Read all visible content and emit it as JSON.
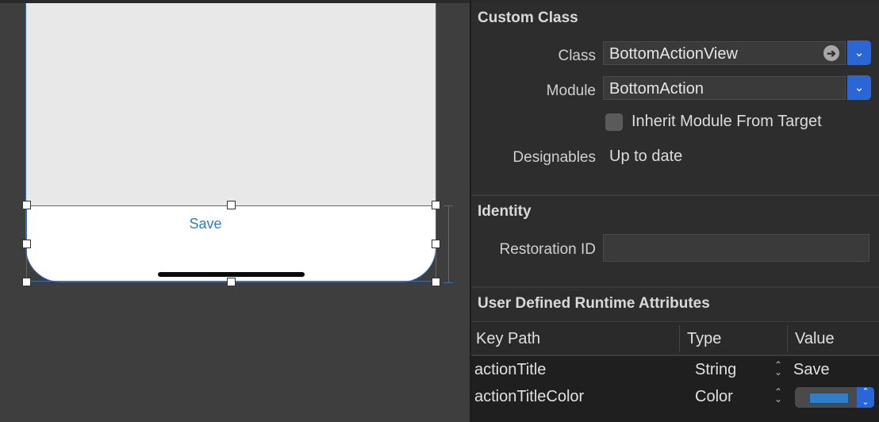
{
  "canvas": {
    "save_label": "Save"
  },
  "custom_class": {
    "title": "Custom Class",
    "class_label": "Class",
    "class_value": "BottomActionView",
    "module_label": "Module",
    "module_value": "BottomAction",
    "inherit_label": "Inherit Module From Target",
    "designables_label": "Designables",
    "designables_value": "Up to date"
  },
  "identity": {
    "title": "Identity",
    "restoration_label": "Restoration ID",
    "restoration_value": ""
  },
  "runtime_attributes": {
    "title": "User Defined Runtime Attributes",
    "columns": [
      "Key Path",
      "Type",
      "Value"
    ],
    "rows": [
      {
        "key_path": "actionTitle",
        "type": "String",
        "value": "Save"
      },
      {
        "key_path": "actionTitleColor",
        "type": "Color",
        "value_color": "#2f7ec7"
      }
    ]
  },
  "icons": {
    "arrow": "➔",
    "chevron": "⌄",
    "stepper_up": "⌃",
    "stepper_down": "⌄"
  }
}
